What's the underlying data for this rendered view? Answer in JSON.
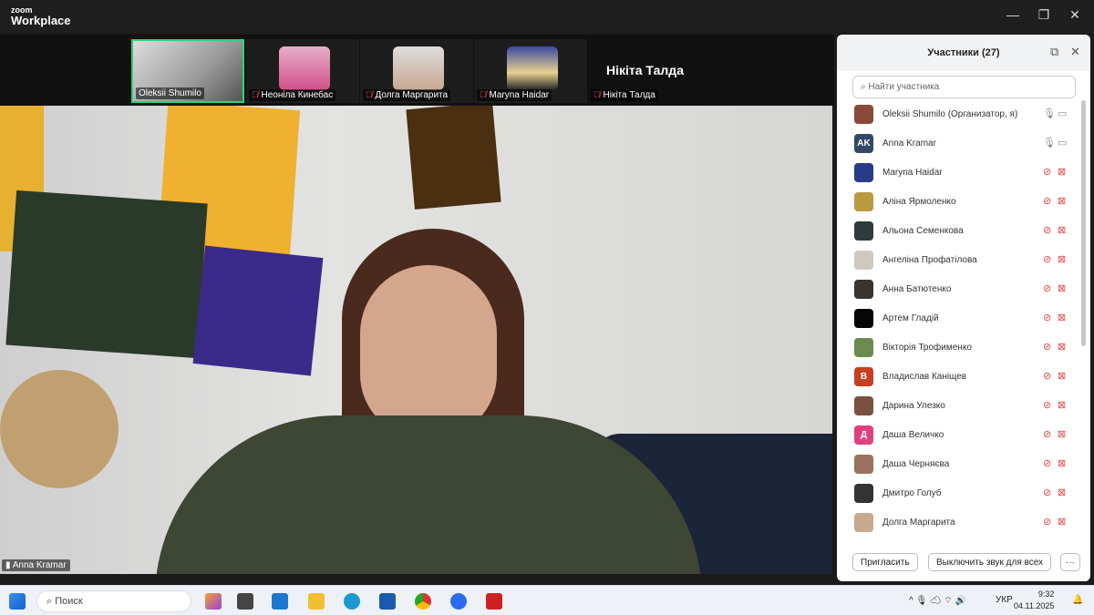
{
  "app": {
    "logo_top": "zoom",
    "logo_bottom": "Workplace"
  },
  "strip": {
    "tiles": [
      {
        "name": "Oleksii Shumilo",
        "muted": false
      },
      {
        "name": "Неоніла Кинебас",
        "muted": true
      },
      {
        "name": "Долга Маргарита",
        "muted": true
      },
      {
        "name": "Maryna Haidar",
        "muted": true
      },
      {
        "name": "Нікіта Талда",
        "muted": true,
        "big_name": "Нікіта Талда"
      }
    ]
  },
  "video": {
    "speaker": "Anna Kramar"
  },
  "panel": {
    "title": "Участники (27)",
    "search_placeholder": "Найти участника",
    "participants": [
      {
        "name": "Oleksii Shumilo (Организатор, я)",
        "muted": false,
        "initials": "",
        "color": "#8a4a3a"
      },
      {
        "name": "Anna Kramar",
        "muted": false,
        "initials": "AK",
        "color": "#334766"
      },
      {
        "name": "Maryna Haidar",
        "muted": true,
        "initials": "",
        "color": "#2a3a8a"
      },
      {
        "name": "Аліна Ярмоленко",
        "muted": true,
        "initials": "",
        "color": "#b89a40"
      },
      {
        "name": "Альона Семенкова",
        "muted": true,
        "initials": "",
        "color": "#2d3b3a"
      },
      {
        "name": "Ангеліна Профатілова",
        "muted": true,
        "initials": "",
        "color": "#cfc8c0"
      },
      {
        "name": "Анна Батютенко",
        "muted": true,
        "initials": "",
        "color": "#3a3430"
      },
      {
        "name": "Артем Гладій",
        "muted": true,
        "initials": "",
        "color": "#050505"
      },
      {
        "name": "Вікторія Трофименко",
        "muted": true,
        "initials": "",
        "color": "#6a8a50"
      },
      {
        "name": "Владислав Каніщев",
        "muted": true,
        "initials": "В",
        "color": "#c63f22"
      },
      {
        "name": "Дарина Улезко",
        "muted": true,
        "initials": "",
        "color": "#7a5040"
      },
      {
        "name": "Даша Величко",
        "muted": true,
        "initials": "Д",
        "color": "#e0407e"
      },
      {
        "name": "Даша Черняєва",
        "muted": true,
        "initials": "",
        "color": "#9a7060"
      },
      {
        "name": "Дмитро Голуб",
        "muted": true,
        "initials": "",
        "color": "#333"
      },
      {
        "name": "Долга Маргарита",
        "muted": true,
        "initials": "",
        "color": "#c9a890"
      }
    ],
    "invite": "Пригласить",
    "mute_all": "Выключить звук для всех",
    "more": "···"
  },
  "taskbar": {
    "search": "Поиск",
    "lang": "УКР",
    "time": "9:32",
    "date": "04.11.2025"
  }
}
